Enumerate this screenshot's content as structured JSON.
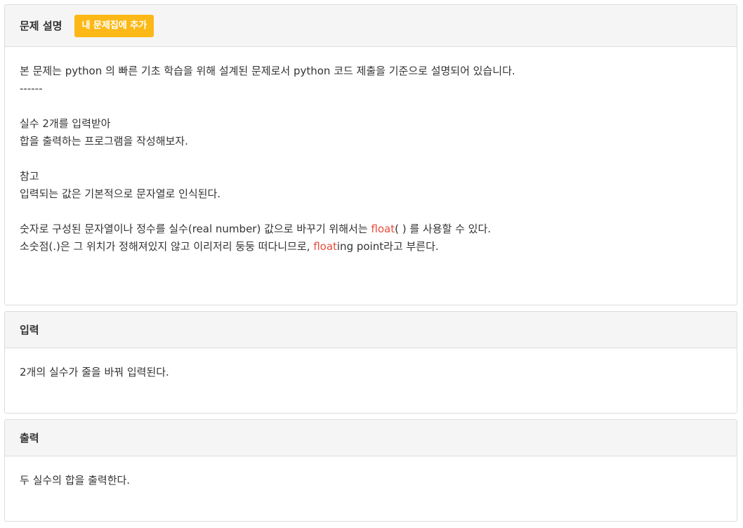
{
  "description": {
    "title": "문제 설명",
    "add_button": "내 문제집에 추가",
    "lines": {
      "l1": "본 문제는 python 의 빠른 기초 학습을 위해 설계된 문제로서 python 코드 제출을 기준으로 설명되어 있습니다.",
      "l2": "------",
      "l3": "실수 2개를 입력받아",
      "l4": "합을 출력하는 프로그램을 작성해보자.",
      "l5": "참고",
      "l6": "입력되는 값은 기본적으로 문자열로 인식된다.",
      "l7_a": "숫자로 구성된 문자열이나 정수를 실수(real number) 값으로 바꾸기 위해서는 ",
      "l7_hl": "float",
      "l7_b": "( ) 를 사용할 수 있다.",
      "l8_a": "소숫점(.)은 그 위치가 정해져있지 않고 이리저리 둥둥 떠다니므로, ",
      "l8_hl": "float",
      "l8_b": "ing point라고 부른다."
    }
  },
  "input": {
    "title": "입력",
    "text": "2개의 실수가 줄을 바꿔 입력된다."
  },
  "output": {
    "title": "출력",
    "text": "두 실수의 합을 출력한다."
  },
  "colors": {
    "button_bg": "#fcb816",
    "highlight": "#e74c3c",
    "heading_bg": "#f5f5f5",
    "border": "#dddddd"
  }
}
